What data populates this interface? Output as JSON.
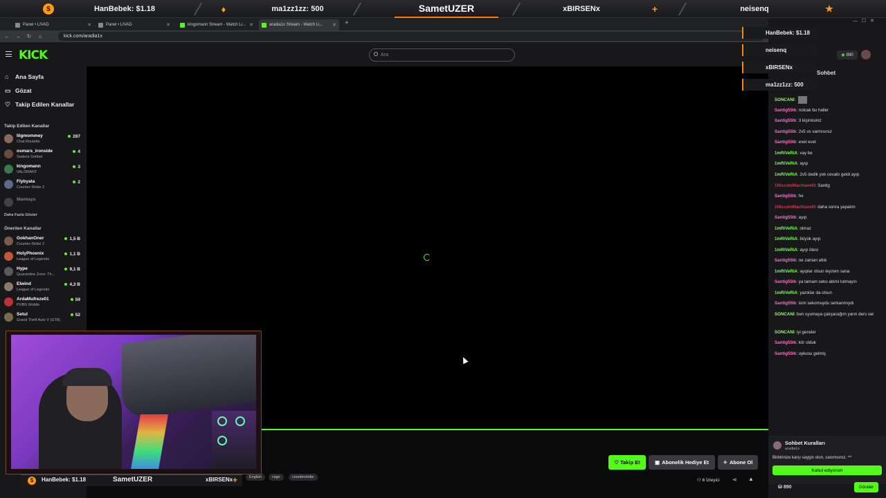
{
  "overlay_top": {
    "left": "HanBebek: $1.18",
    "center_left": "ma1zz1zz: 500",
    "title": "SametUZER",
    "center_right": "xBIRSENx",
    "right": "neisenq"
  },
  "browser": {
    "tabs": [
      {
        "label": "Panel • LIVAD"
      },
      {
        "label": "Panel • LIVAD"
      },
      {
        "label": "kingomann Stream - Watch Li..."
      },
      {
        "label": "aradia1x Stream - Watch Li..."
      }
    ],
    "url": "kick.com/aradia1x"
  },
  "header": {
    "logo": "KICK",
    "search_placeholder": "Ara"
  },
  "sidebar": {
    "nav": [
      "Ana Sayfa",
      "Gözat",
      "Takip Edilen Kanallar"
    ],
    "followed_title": "Takip Edilen Kanallar",
    "followed": [
      {
        "name": "lilgmommey",
        "game": "Chat Roulette",
        "viewers": "287"
      },
      {
        "name": "osmars_ironside",
        "game": "Sadece Sohbet",
        "viewers": "4"
      },
      {
        "name": "kingomann",
        "game": "VALORANT",
        "viewers": "3"
      },
      {
        "name": "Flybyata",
        "game": "Counter-Strike 2",
        "viewers": "2"
      },
      {
        "name": "Mamiays",
        "game": "",
        "viewers": ""
      }
    ],
    "show_more": "Daha Fazla Göster",
    "recommended_title": "Önerilen Kanallar",
    "recommended": [
      {
        "name": "GokhanOner",
        "game": "Counter-Strike 2",
        "viewers": "1,5 B"
      },
      {
        "name": "HolyPhoenix",
        "game": "League of Legends",
        "viewers": "1,1 B"
      },
      {
        "name": "Hype",
        "game": "Quarantine Zone: Th...",
        "viewers": "9,1 B"
      },
      {
        "name": "Elwind",
        "game": "League of Legends",
        "viewers": "4,3 B"
      },
      {
        "name": "ArdaMufreze01",
        "game": "PUBG Mobile",
        "viewers": "59"
      },
      {
        "name": "Setul",
        "game": "Grand Theft Auto V (GTA)",
        "viewers": "52"
      }
    ]
  },
  "stream": {
    "buttons": {
      "follow": "♡ Takip Et",
      "gift": "Abonelik Hediye Et",
      "subscribe": "Abone Ol"
    },
    "tags": [
      "English",
      "csgo",
      "counterstrike"
    ],
    "viewers_count": "6",
    "viewers_label": "İzleyici"
  },
  "overlay_bottom": {
    "left": "HanBebek: $1.18",
    "title": "SametUZER",
    "right": "xBIRSENx"
  },
  "chat": {
    "title": "Sohbet",
    "points_badge": "890",
    "notifications": [
      "HanBebek: $1.18",
      "neisenq",
      "xBIRSENx",
      "ma1zz1zz: 500"
    ],
    "messages": [
      {
        "user": "SONCANI",
        "text": ""
      },
      {
        "user": "Santig55tk",
        "text": "nolcak bu haller"
      },
      {
        "user": "Santig55tk",
        "text": "3 kişimisiniz"
      },
      {
        "user": "Santig55tk",
        "text": "2v5 vs varmısınız"
      },
      {
        "user": "Santig55tk",
        "text": "evet evet"
      },
      {
        "user": "1mRiVeRiA",
        "text": "vay be"
      },
      {
        "user": "1mRiVeRiA",
        "text": "ayıp"
      },
      {
        "user": "1mRiVeRiA",
        "text": "2v5 dedik yok cevabı geldi ayıp"
      },
      {
        "user": "1NiccoloMachiavelli",
        "text": "Santig"
      },
      {
        "user": "Santig55tk",
        "text": "he"
      },
      {
        "user": "1NiccoloMachiavelli",
        "text": "daha sonra yapalım"
      },
      {
        "user": "Santig55tk",
        "text": "ayıp"
      },
      {
        "user": "1mRiVeRiA",
        "text": "olmaz"
      },
      {
        "user": "1mRiVeRiA",
        "text": "büyük ayıp"
      },
      {
        "user": "1mRiVeRiA",
        "text": "ayıp ötesi"
      },
      {
        "user": "Santig55tk",
        "text": "ne zaman attık"
      },
      {
        "user": "1mRiVeRiA",
        "text": "ayıplar olsun teyzem sana"
      },
      {
        "user": "Santig55tk",
        "text": "ya tamam seko abimi tutmayın"
      },
      {
        "user": "1mRiVeRiA",
        "text": "yazıklar da olsun"
      },
      {
        "user": "Santig55tk",
        "text": "ismi sekomuydu serkanmıydı"
      },
      {
        "user": "SONCANI",
        "text": "ben uyumaya çalışacağım yarın ders var"
      },
      {
        "user": "SONCANI",
        "text": "iyi geceler"
      },
      {
        "user": "Santig55tk",
        "text": "kör olduk"
      },
      {
        "user": "Santig55tk",
        "text": "uykusu gelmiş"
      }
    ],
    "rules_title": "Sohbet Kuralları",
    "rules_channel": "aradia1x",
    "rules_text": "Birbirinize karşı saygılı olun, canımsınız. ^^",
    "rules_accept": "Kabul ediyorum",
    "points": "890",
    "send": "Gönder"
  },
  "colors": {
    "brand": "#53fc18",
    "overlay_accent": "#ff7a00"
  }
}
